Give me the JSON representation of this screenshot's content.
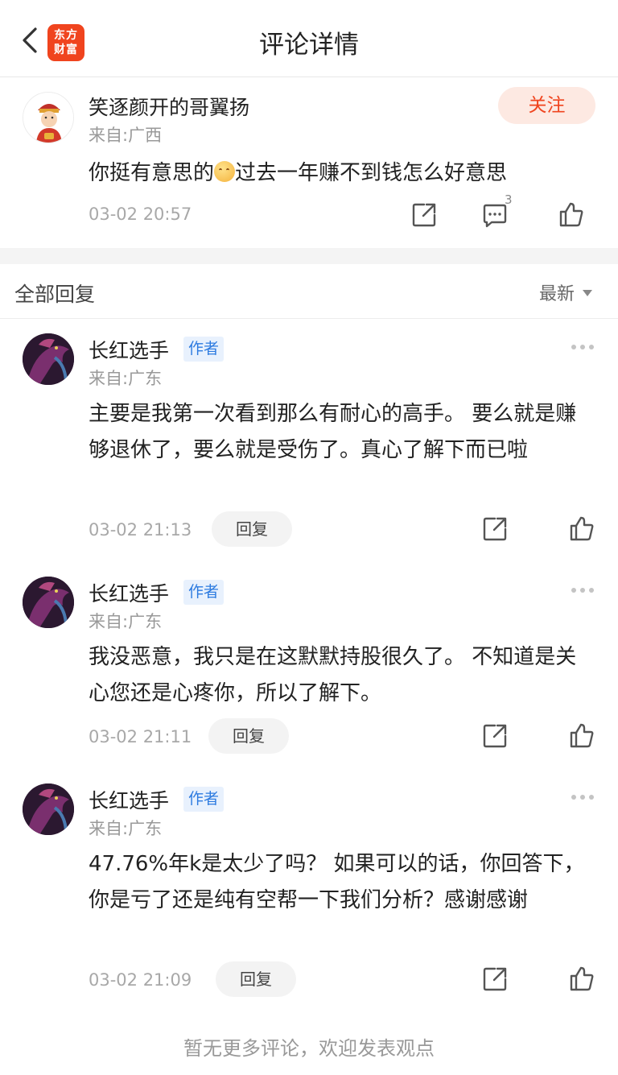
{
  "header": {
    "title": "评论详情",
    "logo_line1": "东方",
    "logo_line2": "财富",
    "brand_color": "#f0441e"
  },
  "main_comment": {
    "username": "笑逐颜开的哥翼扬",
    "location": "来自:广西",
    "follow_label": "关注",
    "text_before_emoji": "你挺有意思的",
    "emoji": "smirk-face-emoji",
    "text_after_emoji": "过去一年赚不到钱怎么好意思",
    "time": "03-02 20:57",
    "comment_count": "3"
  },
  "replies_section": {
    "title": "全部回复",
    "sort_label": "最新"
  },
  "replies": [
    {
      "username": "长红选手",
      "badge": "作者",
      "location": "来自:广东",
      "text": "主要是我第一次看到那么有耐心的高手。 要么就是赚够退休了，要么就是受伤了。真心了解下而已啦",
      "time": "03-02 21:13",
      "reply_label": "回复"
    },
    {
      "username": "长红选手",
      "badge": "作者",
      "location": "来自:广东",
      "text": "我没恶意，我只是在这默默持股很久了。 不知道是关心您还是心疼你，所以了解下。",
      "time": "03-02 21:11",
      "reply_label": "回复"
    },
    {
      "username": "长红选手",
      "badge": "作者",
      "location": "来自:广东",
      "text": "47.76%年k是太少了吗？ 如果可以的话，你回答下，你是亏了还是纯有空帮一下我们分析？感谢感谢",
      "time": "03-02 21:09",
      "reply_label": "回复"
    }
  ],
  "footer": {
    "note": "暂无更多评论，欢迎发表观点"
  }
}
